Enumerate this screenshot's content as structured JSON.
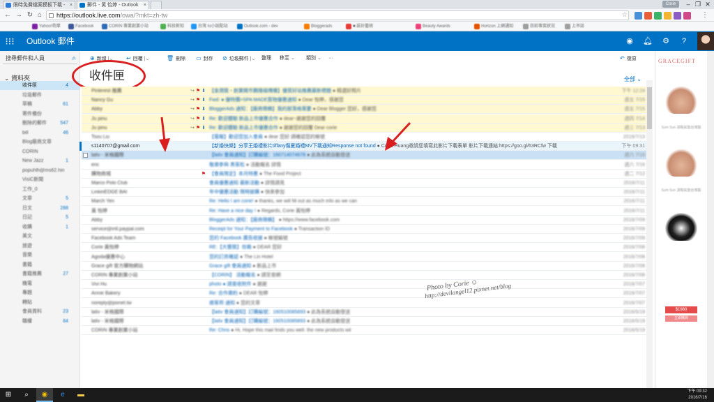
{
  "browser": {
    "tabs": [
      {
        "title": "限時免費檔案模板下載 -",
        "active": false
      },
      {
        "title": "郵件 - 黃 怡婷 - Outlook",
        "active": true
      }
    ],
    "url_host": "https://outlook.live.com",
    "url_path": "/owa/?mkt=zh-tw",
    "user_badge": "Corie",
    "bookmarks": [
      "Yahoo!奇摩",
      "Facebook",
      "CORIN 專業創業小站",
      "科技新知",
      "台灣 Io小說配站",
      "Outlook.com - dev",
      "Bloggerads",
      "■ 設計藝術",
      "Beauty Awards",
      "Horizon 上網通知",
      "目前專案狀況",
      "上市誌"
    ]
  },
  "outlook": {
    "brand": "Outlook 郵件",
    "search_placeholder": "搜尋郵件和人員",
    "folder_header": "資料夾",
    "folders": [
      {
        "name": "收件匣",
        "count": "4",
        "selected": true
      },
      {
        "name": "垃圾郵件",
        "count": ""
      },
      {
        "name": "草稿",
        "count": "61"
      },
      {
        "name": "寄件備份",
        "count": ""
      },
      {
        "name": "刪除的郵件",
        "count": "547"
      },
      {
        "name": "bill",
        "count": "46"
      },
      {
        "name": "Blog廠商文章",
        "count": ""
      },
      {
        "name": "CORIN",
        "count": ""
      },
      {
        "name": "New Jazz",
        "count": "1"
      },
      {
        "name": "popuhlh@ms62.hin",
        "count": ""
      },
      {
        "name": "VisiC新聞",
        "count": ""
      },
      {
        "name": "工作_0",
        "count": ""
      },
      {
        "name": "文章",
        "count": "5"
      },
      {
        "name": "日文",
        "count": "288"
      },
      {
        "name": "日記",
        "count": "5"
      },
      {
        "name": "收購",
        "count": "1"
      },
      {
        "name": "美文",
        "count": ""
      },
      {
        "name": "旅遊",
        "count": ""
      },
      {
        "name": "音樂",
        "count": ""
      },
      {
        "name": "書籍",
        "count": ""
      },
      {
        "name": "書籍推薦",
        "count": "27"
      },
      {
        "name": "機電",
        "count": ""
      },
      {
        "name": "專題",
        "count": ""
      },
      {
        "name": "轉貼",
        "count": ""
      },
      {
        "name": "會員資料",
        "count": "23"
      },
      {
        "name": "職權",
        "count": "84"
      }
    ],
    "commands": {
      "new": "新增",
      "reply": "回覆",
      "delete": "刪除",
      "archive": "封存",
      "junk": "垃圾郵件",
      "sweep": "整理",
      "move": "移至",
      "categories": "類別",
      "undo": "復原"
    },
    "inbox_title": "收件匣",
    "filter_label": "全部",
    "mails": [
      {
        "sender": "Pinterest 推薦",
        "subject": "【金潤獎‧創業開市鵝隨福傳播】優質好站推薦最新標題",
        "preview": "● 精選好照片",
        "date": "下午 12:24",
        "flag": true,
        "pin": true,
        "style": "flagged"
      },
      {
        "sender": "Nancy Gu",
        "subject": "Fwd: ● 優特價>SPA MADE質物優惠通知",
        "preview": "● Dear 怡婷，感謝您",
        "date": "週五 7/15",
        "flag": true,
        "pin": true,
        "style": "flagged"
      },
      {
        "sender": "Abby",
        "subject": "BloggerAds 通知：【廠商徵稿】我的部落格需要",
        "preview": "● Dear Blogger 您好，感謝您",
        "date": "週五 7/15",
        "flag": true,
        "pin": true,
        "style": "flagged"
      },
      {
        "sender": "Ju pinu",
        "subject": "Re: 歡迎體驗 新品上市優惠合作",
        "preview": "● dear~謝謝您的回覆",
        "date": "週四 7/14",
        "flag": true,
        "pin": true,
        "style": "flagged"
      },
      {
        "sender": "Ju pinu",
        "subject": "Re: 歡迎體驗 新品上市優惠合作",
        "preview": "● 謝謝您的回覆 Dear corie",
        "date": "週三 7/13",
        "flag": true,
        "pin": true,
        "style": "flagged"
      },
      {
        "sender": "Tsou Liu",
        "subject": "【電報】歡迎您加入會員",
        "preview": "● dear 您好 請確認您的帳號",
        "date": "2016/7/13",
        "flag": false,
        "pin": false,
        "style": "plain"
      },
      {
        "sender": "s1140707@gmail.com",
        "subject": "【新婚快樂】分享王婚禮影片tiffany傷夏婚禮MV下載通知Response not found",
        "preview": "● Corie Huang邀請您填寫此影片下載表單 影片下載連結:https://goo.gl/63RCfw 下載",
        "date": "下午 09:31",
        "flag": false,
        "pin": false,
        "style": "clear"
      },
      {
        "sender": "lativ - 米格國際",
        "subject": "【lativ 會員通知】訂購編號：160714074678",
        "preview": "● 此為系統自動發送",
        "date": "週六 7/16",
        "flag": false,
        "pin": false,
        "style": "hilite"
      },
      {
        "sender": "eric",
        "subject": "敬邀參與 黑客松",
        "preview": "● 活動報名 詳情",
        "date": "週六 7/16",
        "flag": false,
        "pin": false,
        "style": "plain"
      },
      {
        "sender": "購物商城",
        "subject": "【會員限定】本月特惠",
        "preview": "● The Food Project",
        "date": "週二 7/12",
        "flag": true,
        "pin": false,
        "style": "plain"
      },
      {
        "sender": "Marco Polo Club",
        "subject": "會員優惠通知 最新活動",
        "preview": "● 詳情請見",
        "date": "2016/7/11",
        "flag": false,
        "pin": false,
        "style": "plain"
      },
      {
        "sender": "LinkinEDGE BAI",
        "subject": "年中優惠活動 限時搶購",
        "preview": "● 快來參加",
        "date": "2016/7/11",
        "flag": false,
        "pin": false,
        "style": "plain"
      },
      {
        "sender": "March Yen",
        "subject": "Re: Hello I am corie!",
        "preview": "● thanks, we will fill out as much info as we can",
        "date": "2016/7/11",
        "flag": false,
        "pin": false,
        "style": "plain"
      },
      {
        "sender": "黃 怡婷",
        "subject": "Re: Have a nice day !",
        "preview": "● Regards, Corie 黃怡婷",
        "date": "2016/7/11",
        "flag": false,
        "pin": false,
        "style": "plain"
      },
      {
        "sender": "Abby",
        "subject": "BloggerAds 通知：【廠商徵稿】",
        "preview": "● https://www.facebook.com",
        "date": "2016/7/09",
        "flag": false,
        "pin": false,
        "style": "plain"
      },
      {
        "sender": "service@intl.paypal.com",
        "subject": "Receipt for Your Payment to Facebook",
        "preview": "● Transaction ID",
        "date": "2016/7/09",
        "flag": false,
        "pin": false,
        "style": "plain"
      },
      {
        "sender": "Facebook Ads Team",
        "subject": "您的 Facebook 廣告收據",
        "preview": "● 帳號編號",
        "date": "2016/7/09",
        "flag": false,
        "pin": false,
        "style": "plain"
      },
      {
        "sender": "Corie 黃怡婷",
        "subject": "RE:【大豐獎】信箱",
        "preview": "● DEAR 您好",
        "date": "2016/7/08",
        "flag": false,
        "pin": false,
        "style": "plain"
      },
      {
        "sender": "Agoda優惠中心",
        "subject": "您的訂房確認",
        "preview": "● The Lin Hotel",
        "date": "2016/7/08",
        "flag": false,
        "pin": false,
        "style": "plain"
      },
      {
        "sender": "Grace gift 官方購物網站",
        "subject": "Grace gift 會員通知",
        "preview": "● 新品上市",
        "date": "2016/7/08",
        "flag": false,
        "pin": false,
        "style": "plain"
      },
      {
        "sender": "CORIN 專業創業小站",
        "subject": "【CORIN】 活動報名",
        "preview": "● 請至官網",
        "date": "2016/7/08",
        "flag": false,
        "pin": false,
        "style": "plain"
      },
      {
        "sender": "Vivi Hu",
        "subject": "photo ● 請查收附件",
        "preview": "● 謝謝",
        "date": "2016/7/07",
        "flag": false,
        "pin": false,
        "style": "plain"
      },
      {
        "sender": "Annie Bakery",
        "subject": "Re: 合作邀約",
        "preview": "● DEAR 怡婷",
        "date": "2016/7/07",
        "flag": false,
        "pin": false,
        "style": "plain"
      },
      {
        "sender": "noreply@pixnet.tw",
        "subject": "痞客邦 通知",
        "preview": "● 您的文章",
        "date": "2016/7/07",
        "flag": false,
        "pin": false,
        "style": "plain"
      },
      {
        "sender": "lativ - 米格國際",
        "subject": "【lativ 會員通知】訂購編號：160510085893",
        "preview": "● 此為系統自動發送",
        "date": "2016/5/19",
        "flag": false,
        "pin": false,
        "style": "plain"
      },
      {
        "sender": "lativ - 米格國際",
        "subject": "【lativ 會員通知】訂購編號：160510085893",
        "preview": "● 此為系統自動發送",
        "date": "2016/5/19",
        "flag": false,
        "pin": false,
        "style": "plain"
      },
      {
        "sender": "CORIN 專業創業小站",
        "subject": "Re: Chris",
        "preview": "● Hi, Hope this mail finds you well. the new products wil",
        "date": "2016/5/19",
        "flag": false,
        "pin": false,
        "style": "plain"
      }
    ]
  },
  "ad": {
    "logo": "GRACEGIFT",
    "caption": "Sum Sun 涼鞋氣墊台灣製",
    "price": "$1980",
    "cta": "立即購買"
  },
  "watermark": {
    "line1": "Photo by Corie ☺",
    "line2": "http://devilangel12.pixnet.net/blog"
  },
  "clock": {
    "time": "下午 09:32",
    "date": "2016/7/16"
  }
}
